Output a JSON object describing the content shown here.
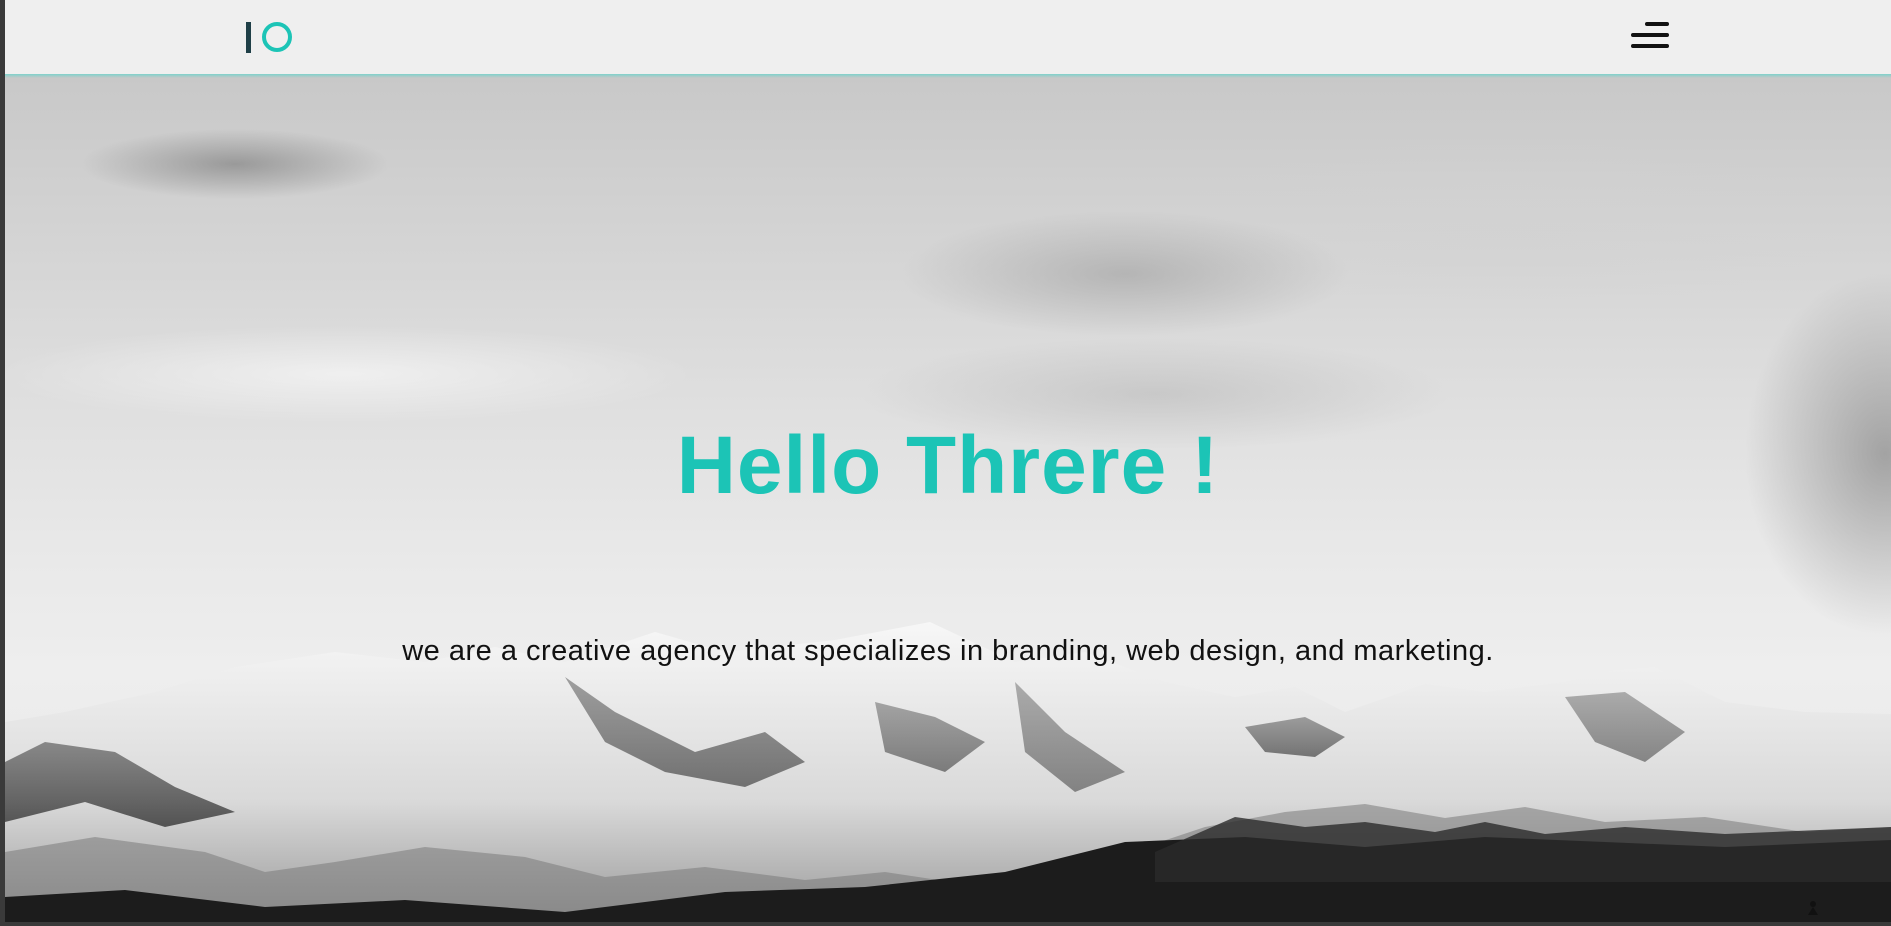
{
  "header": {
    "logo_name": "logo-icon",
    "menu_icon": "hamburger-menu-icon"
  },
  "hero": {
    "title": "Hello Threre !",
    "subtitle": "we are a creative agency that specializes in branding, web design, and marketing."
  },
  "colors": {
    "accent": "#1cc4b6",
    "logo_dark": "#1f3f47",
    "nav_background": "#efefef",
    "text_dark": "#111111"
  }
}
